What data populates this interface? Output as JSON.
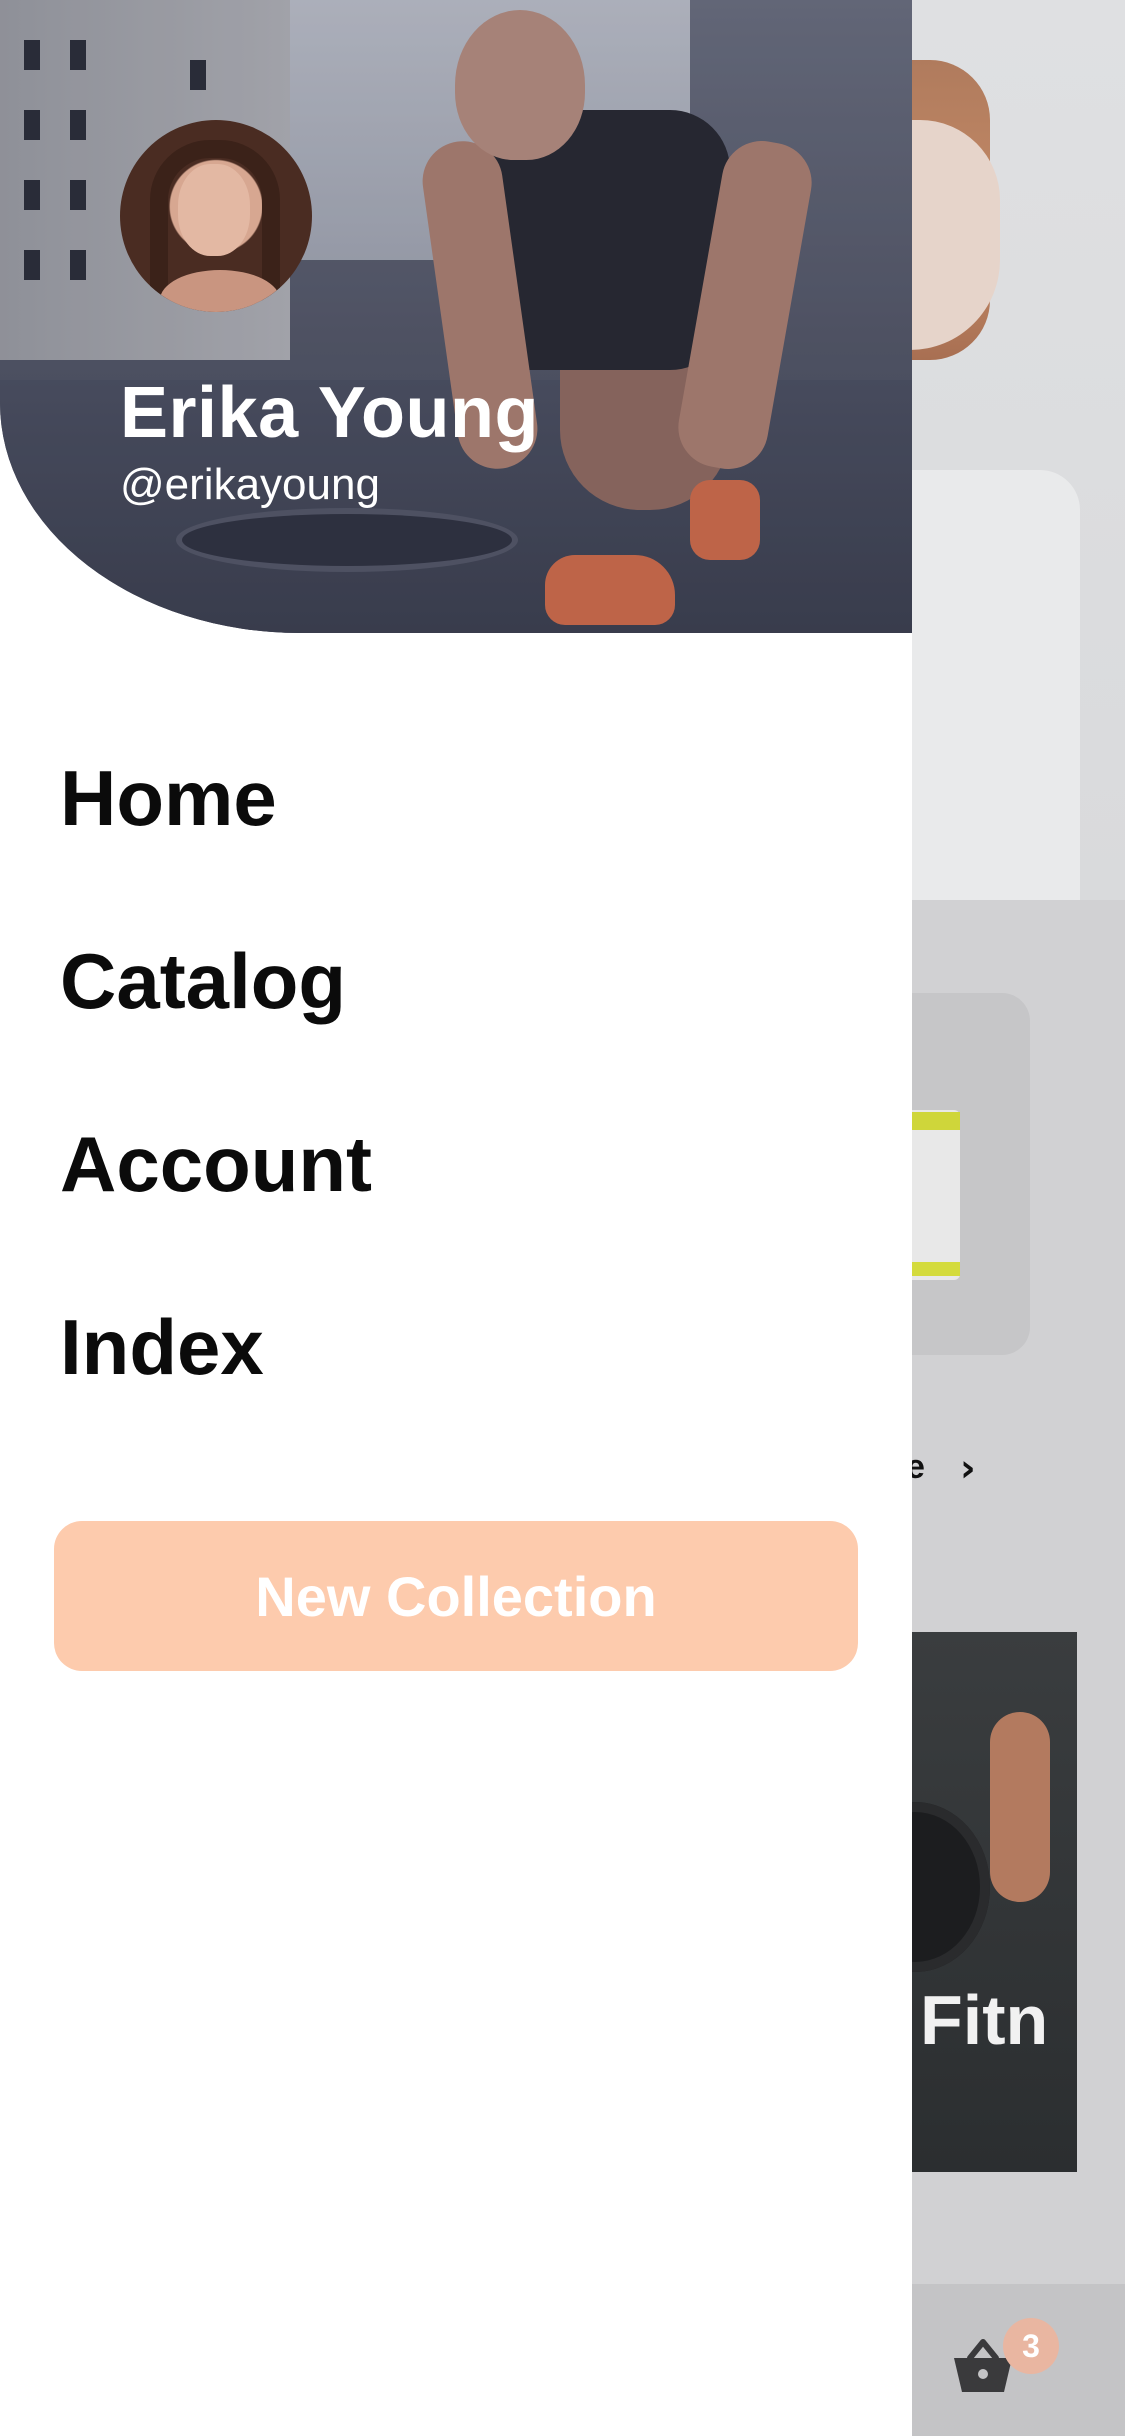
{
  "drawer": {
    "user": {
      "name": "Erika Young",
      "handle": "@erikayoung"
    },
    "menu": [
      {
        "label": "Home"
      },
      {
        "label": "Catalog"
      },
      {
        "label": "Account"
      },
      {
        "label": "Index"
      }
    ],
    "cta_label": "New Collection"
  },
  "background": {
    "section_link_fragment": "e",
    "banner_word_fragment": "Fitn",
    "cart": {
      "icon": "basket-icon",
      "badge_count": "3"
    }
  },
  "colors": {
    "accent": "#FDCBAD",
    "badge": "#E9B6A1",
    "menu_text": "#0B0B0B"
  }
}
